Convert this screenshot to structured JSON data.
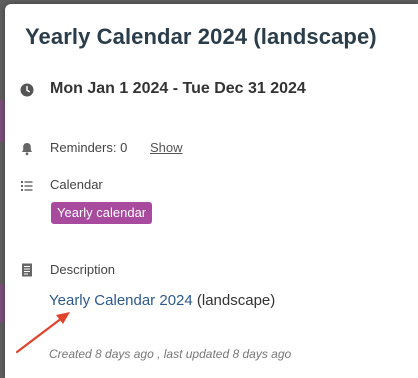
{
  "event": {
    "title": "Yearly Calendar 2024 (landscape)",
    "date_range": "Mon Jan 1 2024 - Tue Dec 31 2024",
    "reminders": {
      "label": "Reminders: 0",
      "show_link": "Show"
    },
    "calendar": {
      "label": "Calendar",
      "name": "Yearly calendar",
      "color": "#a84a9e"
    },
    "description": {
      "label": "Description",
      "link_text": "Yearly Calendar 2024",
      "suffix_text": " (landscape)"
    },
    "meta": "Created 8 days ago , last updated 8 days ago"
  },
  "icons": {
    "date": "clock-icon",
    "reminders": "bell-icon",
    "calendar": "list-icon",
    "description": "document-icon"
  },
  "colors": {
    "title": "#2b3d4a",
    "link": "#2c5a8c",
    "arrow": "#e0432b"
  }
}
